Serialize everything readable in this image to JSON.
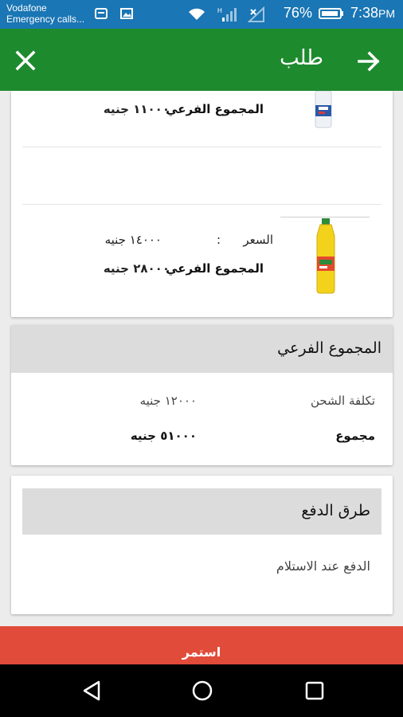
{
  "status_bar": {
    "carrier_line1": "Vodafone",
    "carrier_line2": "Emergency calls...",
    "network": "H",
    "battery": "76%",
    "time": "7:38",
    "ampm": "PM"
  },
  "app_bar": {
    "title": "طلب",
    "close_icon": "close-icon",
    "back_icon": "arrow-right-icon"
  },
  "items": [
    {
      "subtotal_label": "المجموع الفرعي",
      "subtotal_value": "١١٠٠٠ جنيه"
    },
    {
      "price_label": "السعر",
      "price_sep": ":",
      "price_value": "١٤٠٠٠ جنيه",
      "subtotal_label": "المجموع الفرعي",
      "subtotal_value": "٢٨٠٠٠ جنيه"
    }
  ],
  "summary": {
    "title": "المجموع الفرعي",
    "shipping_label": "تكلفة الشحن",
    "shipping_value": "١٢٠٠٠ جنيه",
    "total_label": "مجموع",
    "total_value": "٥١٠٠٠ جنيه"
  },
  "payment": {
    "title": "طرق الدفع",
    "method": "الدفع عند الاستلام"
  },
  "continue_label": "استمر",
  "colors": {
    "status_bar": "#1a76b4",
    "app_bar": "#1e8a2e",
    "continue": "#e14b3a"
  }
}
